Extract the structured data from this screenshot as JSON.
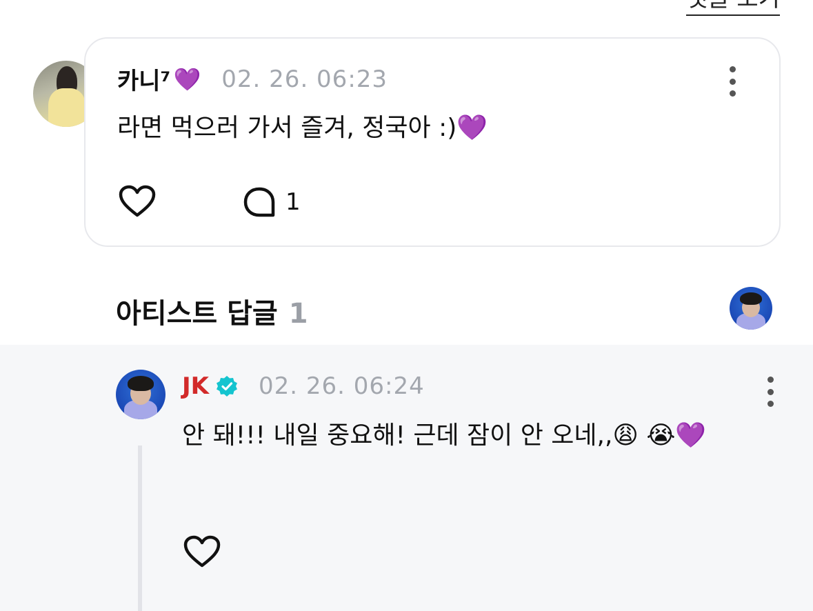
{
  "top_link": "댓글 보기",
  "comment": {
    "author": "카니⁷",
    "author_emoji": "💜",
    "timestamp": "02. 26. 06:23",
    "text": "라면 먹으러 가서 즐겨, 정국아 :)💜",
    "reply_count": "1",
    "icons": [
      "avatar",
      "more-icon",
      "heart-icon",
      "reply-bubble-icon"
    ]
  },
  "artist_section": {
    "title": "아티스트 답글",
    "count": "1"
  },
  "artist_reply": {
    "author": "JK",
    "verified": true,
    "timestamp": "02. 26. 06:24",
    "text": "안 돼!!! 내일 중요해! 근데 잠이 안 오네,,😩 😭💜"
  },
  "colors": {
    "artist_name": "#d22a2a",
    "verified_badge": "#14c4cf",
    "timestamp": "#a3a7ae",
    "card_border": "#e7e8ec",
    "reply_bg": "#f6f7f9"
  }
}
